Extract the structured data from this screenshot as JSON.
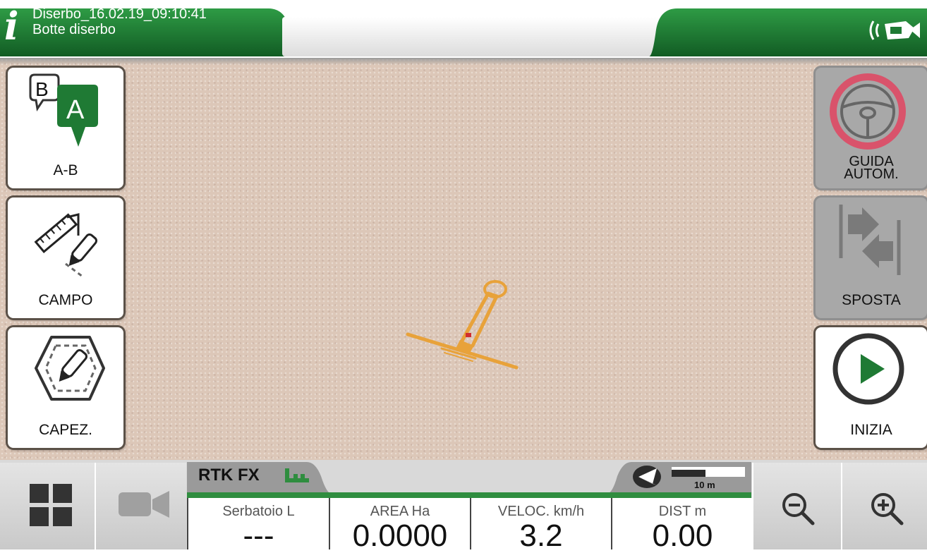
{
  "header": {
    "title_line1": "Diserbo_16.02.19_09:10:41",
    "title_line2": "Botte diserbo",
    "info_icon": "i",
    "status_icon": "gps-signal-icon"
  },
  "left_buttons": [
    {
      "label": "A-B",
      "icon": "ab-line-icon",
      "icon_letter_a": "A",
      "icon_letter_b": "B"
    },
    {
      "label": "CAMPO",
      "icon": "field-draw-icon"
    },
    {
      "label": "CAPEZ.",
      "icon": "headland-icon"
    }
  ],
  "right_buttons": [
    {
      "label": "GUIDA\nAUTOM.",
      "icon": "steering-wheel-icon",
      "enabled": false
    },
    {
      "label": "SPOSTA",
      "icon": "shift-arrows-icon",
      "enabled": false
    },
    {
      "label": "INIZIA",
      "icon": "play-icon",
      "enabled": true
    }
  ],
  "bottom": {
    "gps_status": "RTK FX",
    "scale_label": "10 m",
    "readouts": [
      {
        "label": "Serbatoio L",
        "value": "---"
      },
      {
        "label": "AREA Ha",
        "value": "0.0000"
      },
      {
        "label": "VELOC. km/h",
        "value": "3.2"
      },
      {
        "label": "DIST m",
        "value": "0.00"
      }
    ]
  },
  "colors": {
    "brand_green": "#1f7a34",
    "accent_green": "#2f8d3f",
    "vehicle_orange": "#e8a23a",
    "steering_ring": "#d9536b",
    "field": "#dcc7b8"
  }
}
